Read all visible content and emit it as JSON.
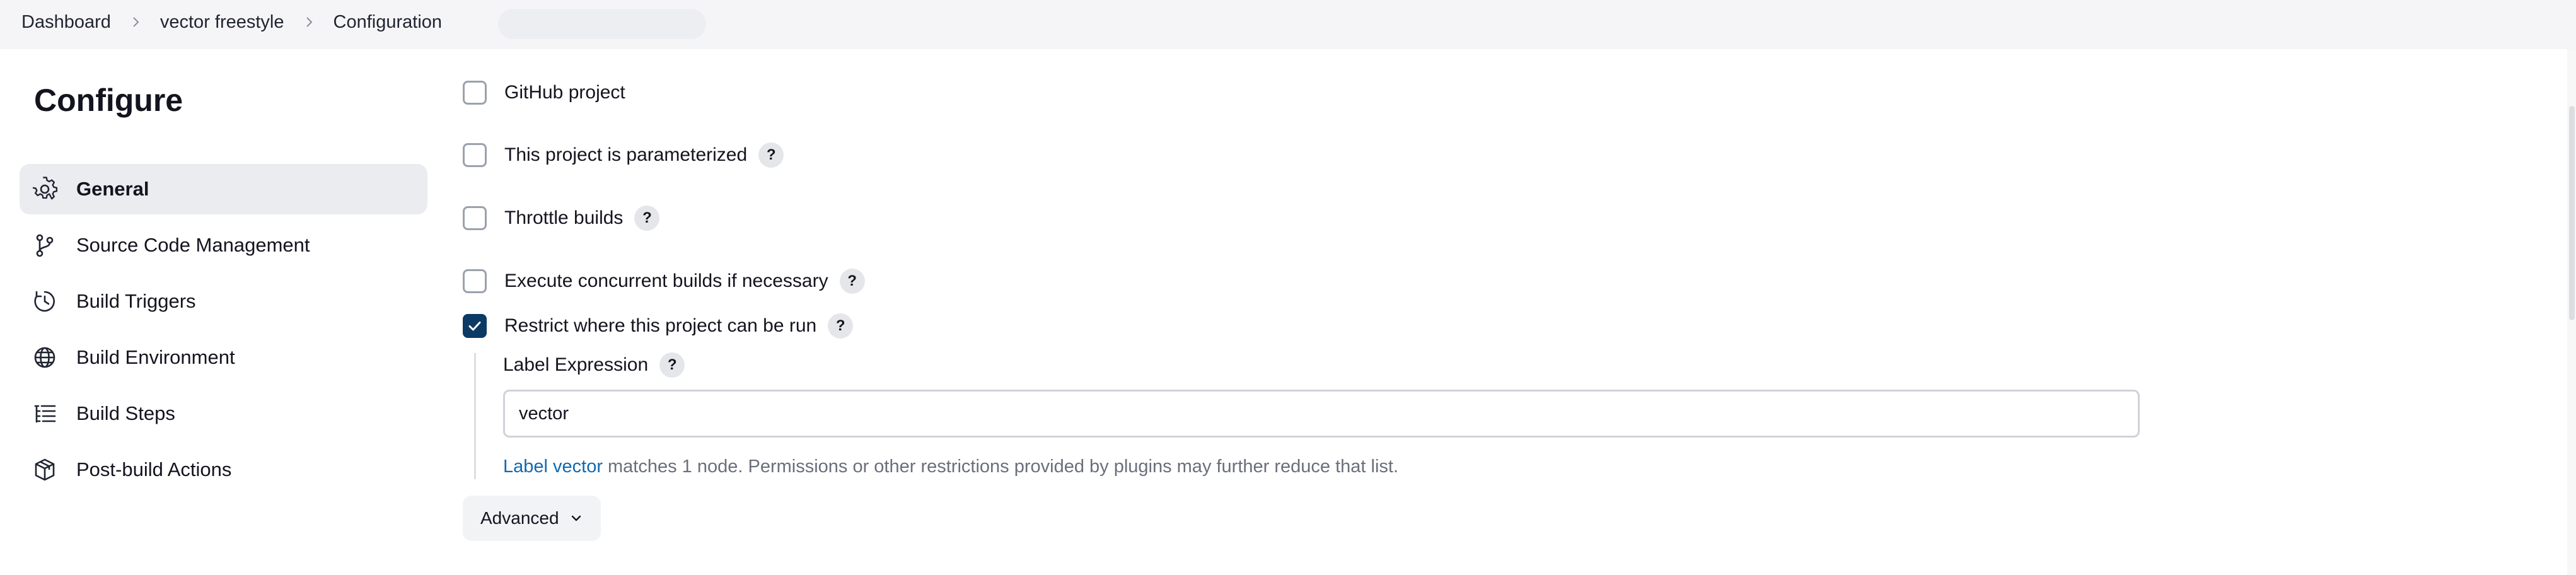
{
  "breadcrumb": {
    "items": [
      "Dashboard",
      "vector freestyle",
      "Configuration"
    ]
  },
  "sidebar": {
    "title": "Configure",
    "items": [
      {
        "label": "General",
        "icon": "gear-icon",
        "active": true
      },
      {
        "label": "Source Code Management",
        "icon": "branch-icon",
        "active": false
      },
      {
        "label": "Build Triggers",
        "icon": "clock-icon",
        "active": false
      },
      {
        "label": "Build Environment",
        "icon": "globe-icon",
        "active": false
      },
      {
        "label": "Build Steps",
        "icon": "list-icon",
        "active": false
      },
      {
        "label": "Post-build Actions",
        "icon": "package-icon",
        "active": false
      }
    ]
  },
  "general": {
    "options": [
      {
        "label": "GitHub project",
        "checked": false,
        "help": false
      },
      {
        "label": "This project is parameterized",
        "checked": false,
        "help": true
      },
      {
        "label": "Throttle builds",
        "checked": false,
        "help": true
      },
      {
        "label": "Execute concurrent builds if necessary",
        "checked": false,
        "help": true
      },
      {
        "label": "Restrict where this project can be run",
        "checked": true,
        "help": true
      }
    ],
    "help_glyph": "?",
    "label_expression": {
      "label": "Label Expression",
      "value": "vector",
      "hint_link": "Label vector",
      "hint_text": "matches 1 node. Permissions or other restrictions provided by plugins may further reduce that list."
    },
    "advanced_label": "Advanced"
  },
  "colors": {
    "accent": "#0b3a64",
    "link": "#1169b0",
    "topbar_bg": "#f5f5f7",
    "active_nav_bg": "#ebecf0"
  }
}
